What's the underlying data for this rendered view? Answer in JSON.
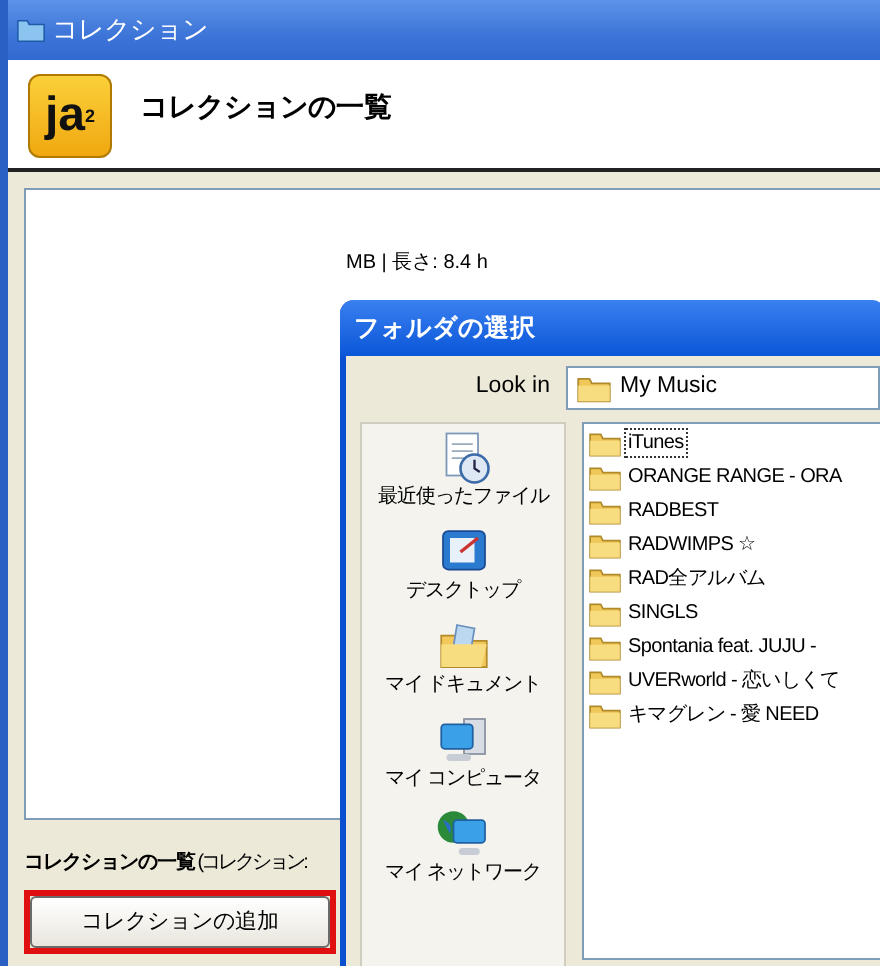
{
  "window": {
    "title": "コレクション"
  },
  "header": {
    "logo": "ja$^{2}$",
    "title": "コレクションの一覧"
  },
  "panel": {
    "info_text": "MB | 長さ: 8.4 h"
  },
  "collection_label": {
    "bold": "コレクションの一覧",
    "rest": "(コレクション:"
  },
  "add_button": {
    "label": "コレクションの追加",
    "highlighted": true
  },
  "dialog": {
    "title": "フォルダの選択",
    "look_in_label": "Look in",
    "look_in_value": "My Music",
    "places": [
      {
        "kind": "recent",
        "label": "最近使ったファイル"
      },
      {
        "kind": "desktop",
        "label": "デスクトップ"
      },
      {
        "kind": "documents",
        "label": "マイ ドキュメント"
      },
      {
        "kind": "computer",
        "label": "マイ コンピュータ"
      },
      {
        "kind": "network",
        "label": "マイ ネットワーク"
      }
    ],
    "folders": [
      {
        "name": "iTunes",
        "selected": true
      },
      {
        "name": "ORANGE RANGE - ORA",
        "selected": false
      },
      {
        "name": "RADBEST",
        "selected": false
      },
      {
        "name": "RADWIMPS ☆",
        "selected": false
      },
      {
        "name": "RAD全アルバム",
        "selected": false
      },
      {
        "name": "SINGLS",
        "selected": false
      },
      {
        "name": "Spontania feat. JUJU -",
        "selected": false
      },
      {
        "name": "UVERworld - 恋いしくて",
        "selected": false
      },
      {
        "name": "キマグレン - 愛 NEED",
        "selected": false
      }
    ]
  }
}
